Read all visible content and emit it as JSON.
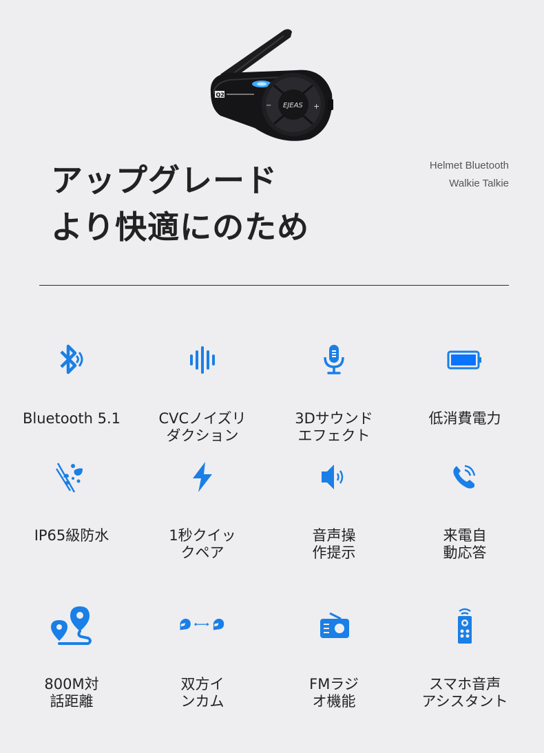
{
  "product": {
    "brand_logo": "EJEAS",
    "model_badge": "Q2",
    "icon": "helmet-intercom-device"
  },
  "subtitle": {
    "line1": "Helmet Bluetooth",
    "line2": "Walkie Talkie"
  },
  "headline": {
    "line1": "アップグレード",
    "line2": "より快適にのため"
  },
  "accent_color": "#1a7fe6",
  "features": [
    {
      "icon": "bluetooth-icon",
      "label": "Bluetooth 5.1"
    },
    {
      "icon": "sound-wave-icon",
      "label": "CVCノイズリ\nダクション"
    },
    {
      "icon": "microphone-icon",
      "label": "3Dサウンド\nエフェクト"
    },
    {
      "icon": "battery-icon",
      "label": "低消費電力"
    },
    {
      "icon": "waterproof-icon",
      "label": "IP65級防水"
    },
    {
      "icon": "lightning-icon",
      "label": "1秒クイッ\nクペア"
    },
    {
      "icon": "speaker-icon",
      "label": "音声操\n作提示"
    },
    {
      "icon": "phone-call-icon",
      "label": "来電自\n動応答"
    },
    {
      "icon": "route-distance-icon",
      "label": "800M対\n話距離"
    },
    {
      "icon": "helmet-to-helmet-icon",
      "label": "双方イ\nンカム"
    },
    {
      "icon": "radio-icon",
      "label": "FMラジ\nオ機能"
    },
    {
      "icon": "remote-assistant-icon",
      "label": "スマホ音声\nアシスタント"
    }
  ]
}
